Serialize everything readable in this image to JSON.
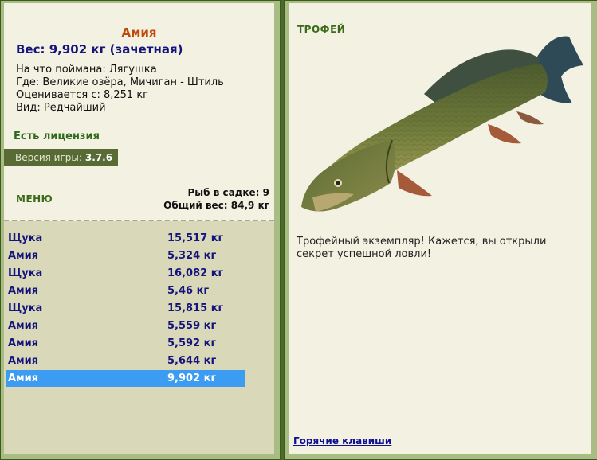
{
  "fish_card": {
    "title": "Амия",
    "weight": "Вес: 9,902 кг (зачетная)",
    "bait": "На что поймана: Лягушка",
    "location": "Где: Великие озёра, Мичиган - Штиль",
    "valued_from": "Оценивается с: 8,251 кг",
    "kind": "Вид: Редчайший"
  },
  "license": "Есть лицензия",
  "version": {
    "label": "Версия игры:",
    "value": "3.7.6"
  },
  "menu_label": "МЕНЮ",
  "net": {
    "count": "Рыб в садке: 9",
    "total_weight": "Общий вес: 84,9 кг"
  },
  "catch_list": [
    {
      "name": "Щука",
      "weight": "15,517 кг"
    },
    {
      "name": "Амия",
      "weight": "5,324 кг"
    },
    {
      "name": "Щука",
      "weight": "16,082 кг"
    },
    {
      "name": "Амия",
      "weight": "5,46 кг"
    },
    {
      "name": "Щука",
      "weight": "15,815 кг"
    },
    {
      "name": "Амия",
      "weight": "5,559 кг"
    },
    {
      "name": "Амия",
      "weight": "5,592 кг"
    },
    {
      "name": "Амия",
      "weight": "5,644 кг"
    },
    {
      "name": "Амия",
      "weight": "9,902 кг"
    }
  ],
  "selected_catch_index": 8,
  "trophy": {
    "label": "ТРОФЕЙ",
    "text": "Трофейный экземпляр! Кажется, вы открыли секрет успешной ловли!"
  },
  "hotkeys_link": "Горячие клавиши",
  "colors": {
    "frame": "#4a6b2a",
    "panel": "#f3f1e1",
    "list_bg": "#d9d8b9",
    "selected": "#3b9cf2",
    "fish_title": "#c04a0a",
    "catch_text": "#14147c"
  }
}
